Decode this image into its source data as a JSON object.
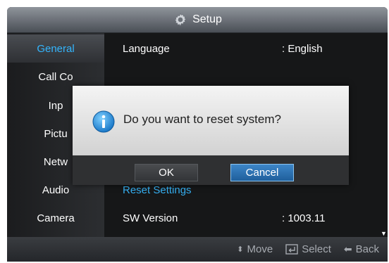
{
  "header": {
    "title": "Setup",
    "icon": "gear-icon"
  },
  "sidebar": {
    "items": [
      {
        "label": "General",
        "selected": true
      },
      {
        "label": "Call Co"
      },
      {
        "label": "Inp"
      },
      {
        "label": "Pictu"
      },
      {
        "label": "Netw"
      },
      {
        "label": "Audio"
      },
      {
        "label": "Camera"
      }
    ]
  },
  "content": {
    "rows": [
      {
        "label": "Language",
        "value": ": English"
      },
      {
        "label": "Reset Settings",
        "value": ""
      },
      {
        "label": "SW Version",
        "value": ": 1003.11"
      }
    ]
  },
  "dialog": {
    "message": "Do you want to reset system?",
    "ok_label": "OK",
    "cancel_label": "Cancel",
    "icon": "info-icon"
  },
  "footer": {
    "move_label": "Move",
    "select_label": "Select",
    "back_label": "Back"
  },
  "colors": {
    "accent": "#33b6ff",
    "selected_button": "#2a6fb0"
  }
}
